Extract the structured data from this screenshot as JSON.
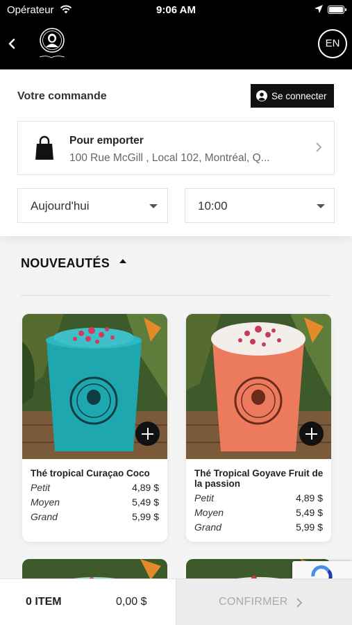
{
  "status_bar": {
    "carrier": "Opérateur",
    "time": "9:06 AM"
  },
  "nav": {
    "language": "EN",
    "logo_text": "H.L. Van Burette"
  },
  "order": {
    "title": "Votre commande",
    "connect_label": "Se connecter",
    "pickup_title": "Pour emporter",
    "pickup_address": "100 Rue McGill , Local 102, Montréal, Q...",
    "date_value": "Aujourd'hui",
    "time_value": "10:00"
  },
  "section": {
    "title": "NOUVEAUTÉS"
  },
  "products": [
    {
      "name": "Thé tropical Curaçao Coco",
      "drink_color": "#1fa7b0",
      "prices": [
        {
          "size": "Petit",
          "price": "4,89 $"
        },
        {
          "size": "Moyen",
          "price": "5,49 $"
        },
        {
          "size": "Grand",
          "price": "5,99 $"
        }
      ]
    },
    {
      "name": "Thé Tropical Goyave Fruit de la passion",
      "drink_color": "#ec7a5c",
      "prices": [
        {
          "size": "Petit",
          "price": "4,89 $"
        },
        {
          "size": "Moyen",
          "price": "5,49 $"
        },
        {
          "size": "Grand",
          "price": "5,99 $"
        }
      ]
    }
  ],
  "footer": {
    "items_label": "0 ITEM",
    "total": "0,00 $",
    "confirm_label": "CONFIRMER"
  },
  "colors": {
    "header_bg": "#000000",
    "accent": "#111111",
    "confirm_disabled_bg": "#ececec"
  }
}
